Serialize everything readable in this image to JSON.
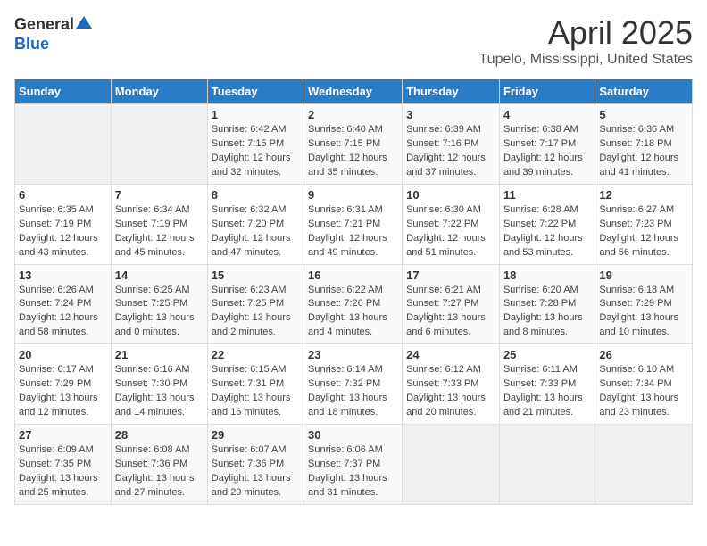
{
  "logo": {
    "general": "General",
    "blue": "Blue"
  },
  "title": "April 2025",
  "location": "Tupelo, Mississippi, United States",
  "days_of_week": [
    "Sunday",
    "Monday",
    "Tuesday",
    "Wednesday",
    "Thursday",
    "Friday",
    "Saturday"
  ],
  "weeks": [
    [
      {
        "day": "",
        "info": ""
      },
      {
        "day": "",
        "info": ""
      },
      {
        "day": "1",
        "sunrise": "Sunrise: 6:42 AM",
        "sunset": "Sunset: 7:15 PM",
        "daylight": "Daylight: 12 hours and 32 minutes."
      },
      {
        "day": "2",
        "sunrise": "Sunrise: 6:40 AM",
        "sunset": "Sunset: 7:15 PM",
        "daylight": "Daylight: 12 hours and 35 minutes."
      },
      {
        "day": "3",
        "sunrise": "Sunrise: 6:39 AM",
        "sunset": "Sunset: 7:16 PM",
        "daylight": "Daylight: 12 hours and 37 minutes."
      },
      {
        "day": "4",
        "sunrise": "Sunrise: 6:38 AM",
        "sunset": "Sunset: 7:17 PM",
        "daylight": "Daylight: 12 hours and 39 minutes."
      },
      {
        "day": "5",
        "sunrise": "Sunrise: 6:36 AM",
        "sunset": "Sunset: 7:18 PM",
        "daylight": "Daylight: 12 hours and 41 minutes."
      }
    ],
    [
      {
        "day": "6",
        "sunrise": "Sunrise: 6:35 AM",
        "sunset": "Sunset: 7:19 PM",
        "daylight": "Daylight: 12 hours and 43 minutes."
      },
      {
        "day": "7",
        "sunrise": "Sunrise: 6:34 AM",
        "sunset": "Sunset: 7:19 PM",
        "daylight": "Daylight: 12 hours and 45 minutes."
      },
      {
        "day": "8",
        "sunrise": "Sunrise: 6:32 AM",
        "sunset": "Sunset: 7:20 PM",
        "daylight": "Daylight: 12 hours and 47 minutes."
      },
      {
        "day": "9",
        "sunrise": "Sunrise: 6:31 AM",
        "sunset": "Sunset: 7:21 PM",
        "daylight": "Daylight: 12 hours and 49 minutes."
      },
      {
        "day": "10",
        "sunrise": "Sunrise: 6:30 AM",
        "sunset": "Sunset: 7:22 PM",
        "daylight": "Daylight: 12 hours and 51 minutes."
      },
      {
        "day": "11",
        "sunrise": "Sunrise: 6:28 AM",
        "sunset": "Sunset: 7:22 PM",
        "daylight": "Daylight: 12 hours and 53 minutes."
      },
      {
        "day": "12",
        "sunrise": "Sunrise: 6:27 AM",
        "sunset": "Sunset: 7:23 PM",
        "daylight": "Daylight: 12 hours and 56 minutes."
      }
    ],
    [
      {
        "day": "13",
        "sunrise": "Sunrise: 6:26 AM",
        "sunset": "Sunset: 7:24 PM",
        "daylight": "Daylight: 12 hours and 58 minutes."
      },
      {
        "day": "14",
        "sunrise": "Sunrise: 6:25 AM",
        "sunset": "Sunset: 7:25 PM",
        "daylight": "Daylight: 13 hours and 0 minutes."
      },
      {
        "day": "15",
        "sunrise": "Sunrise: 6:23 AM",
        "sunset": "Sunset: 7:25 PM",
        "daylight": "Daylight: 13 hours and 2 minutes."
      },
      {
        "day": "16",
        "sunrise": "Sunrise: 6:22 AM",
        "sunset": "Sunset: 7:26 PM",
        "daylight": "Daylight: 13 hours and 4 minutes."
      },
      {
        "day": "17",
        "sunrise": "Sunrise: 6:21 AM",
        "sunset": "Sunset: 7:27 PM",
        "daylight": "Daylight: 13 hours and 6 minutes."
      },
      {
        "day": "18",
        "sunrise": "Sunrise: 6:20 AM",
        "sunset": "Sunset: 7:28 PM",
        "daylight": "Daylight: 13 hours and 8 minutes."
      },
      {
        "day": "19",
        "sunrise": "Sunrise: 6:18 AM",
        "sunset": "Sunset: 7:29 PM",
        "daylight": "Daylight: 13 hours and 10 minutes."
      }
    ],
    [
      {
        "day": "20",
        "sunrise": "Sunrise: 6:17 AM",
        "sunset": "Sunset: 7:29 PM",
        "daylight": "Daylight: 13 hours and 12 minutes."
      },
      {
        "day": "21",
        "sunrise": "Sunrise: 6:16 AM",
        "sunset": "Sunset: 7:30 PM",
        "daylight": "Daylight: 13 hours and 14 minutes."
      },
      {
        "day": "22",
        "sunrise": "Sunrise: 6:15 AM",
        "sunset": "Sunset: 7:31 PM",
        "daylight": "Daylight: 13 hours and 16 minutes."
      },
      {
        "day": "23",
        "sunrise": "Sunrise: 6:14 AM",
        "sunset": "Sunset: 7:32 PM",
        "daylight": "Daylight: 13 hours and 18 minutes."
      },
      {
        "day": "24",
        "sunrise": "Sunrise: 6:12 AM",
        "sunset": "Sunset: 7:33 PM",
        "daylight": "Daylight: 13 hours and 20 minutes."
      },
      {
        "day": "25",
        "sunrise": "Sunrise: 6:11 AM",
        "sunset": "Sunset: 7:33 PM",
        "daylight": "Daylight: 13 hours and 21 minutes."
      },
      {
        "day": "26",
        "sunrise": "Sunrise: 6:10 AM",
        "sunset": "Sunset: 7:34 PM",
        "daylight": "Daylight: 13 hours and 23 minutes."
      }
    ],
    [
      {
        "day": "27",
        "sunrise": "Sunrise: 6:09 AM",
        "sunset": "Sunset: 7:35 PM",
        "daylight": "Daylight: 13 hours and 25 minutes."
      },
      {
        "day": "28",
        "sunrise": "Sunrise: 6:08 AM",
        "sunset": "Sunset: 7:36 PM",
        "daylight": "Daylight: 13 hours and 27 minutes."
      },
      {
        "day": "29",
        "sunrise": "Sunrise: 6:07 AM",
        "sunset": "Sunset: 7:36 PM",
        "daylight": "Daylight: 13 hours and 29 minutes."
      },
      {
        "day": "30",
        "sunrise": "Sunrise: 6:06 AM",
        "sunset": "Sunset: 7:37 PM",
        "daylight": "Daylight: 13 hours and 31 minutes."
      },
      {
        "day": "",
        "info": ""
      },
      {
        "day": "",
        "info": ""
      },
      {
        "day": "",
        "info": ""
      }
    ]
  ]
}
